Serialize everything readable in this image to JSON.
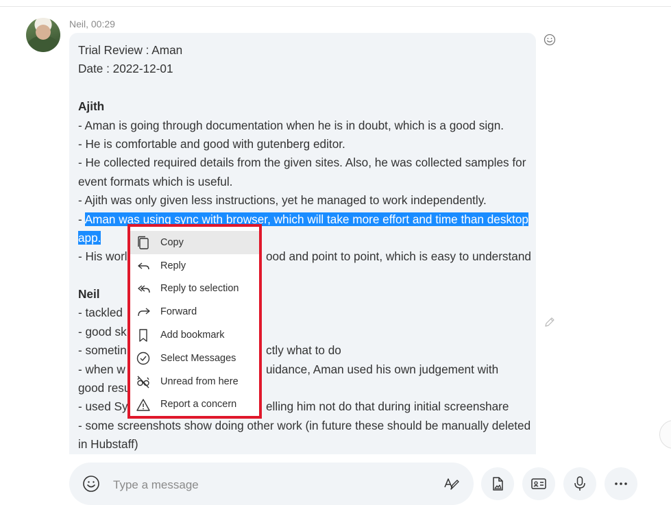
{
  "message": {
    "sender_time": "Neil, 00:29",
    "lines": [
      {
        "text": "Trial Review : Aman"
      },
      {
        "text": "Date : 2022-12-01"
      },
      {
        "blank": true
      },
      {
        "text": "Ajith",
        "bold": true
      },
      {
        "text": "- Aman is going through documentation when he is in doubt, which is a good sign."
      },
      {
        "text": "- He is comfortable and good with gutenberg editor."
      },
      {
        "text": "- He collected required  details from the given sites. Also, he was collected samples for"
      },
      {
        "text": "event formats which is useful."
      },
      {
        "text": "- Ajith was only given less instructions, yet he managed to work independently."
      },
      {
        "prefix": "- ",
        "selected": "Aman was using sync with browser, which will take more effort and time than desktop"
      },
      {
        "selected": "app."
      },
      {
        "text": "- His work … ood and point to point, which is easy to understand",
        "visible_left": "- His worl",
        "visible_right": "ood and point to point, which is easy to understand"
      },
      {
        "blank": true
      },
      {
        "text": "Neil",
        "bold": true
      },
      {
        "visible_left": "- tackled"
      },
      {
        "visible_left": "- good sk"
      },
      {
        "visible_left": "- sometin",
        "visible_right": "ctly what to do"
      },
      {
        "visible_left": "- when w",
        "visible_right": "uidance, Aman used his own judgement with"
      },
      {
        "visible_left": "good resu"
      },
      {
        "visible_left": "- used Sy",
        "visible_right": "elling him not do that during initial screenshare"
      },
      {
        "text": "- some screenshots show doing other work (in future these should be manually deleted"
      },
      {
        "text": "in Hubstaff)"
      }
    ]
  },
  "context_menu": {
    "items": [
      {
        "label": "Copy",
        "icon": "copy-icon",
        "hover": true
      },
      {
        "label": "Reply",
        "icon": "reply-icon"
      },
      {
        "label": "Reply to selection",
        "icon": "reply-all-icon"
      },
      {
        "label": "Forward",
        "icon": "forward-icon"
      },
      {
        "label": "Add bookmark",
        "icon": "bookmark-icon"
      },
      {
        "label": "Select Messages",
        "icon": "check-circle-icon"
      },
      {
        "label": "Unread from here",
        "icon": "glasses-off-icon"
      },
      {
        "label": "Report a concern",
        "icon": "warning-icon"
      }
    ],
    "highlight_color": "#e0182b"
  },
  "composer": {
    "placeholder": "Type a message"
  },
  "colors": {
    "selection": "#1a8cff",
    "bubble": "#f1f4f7"
  }
}
